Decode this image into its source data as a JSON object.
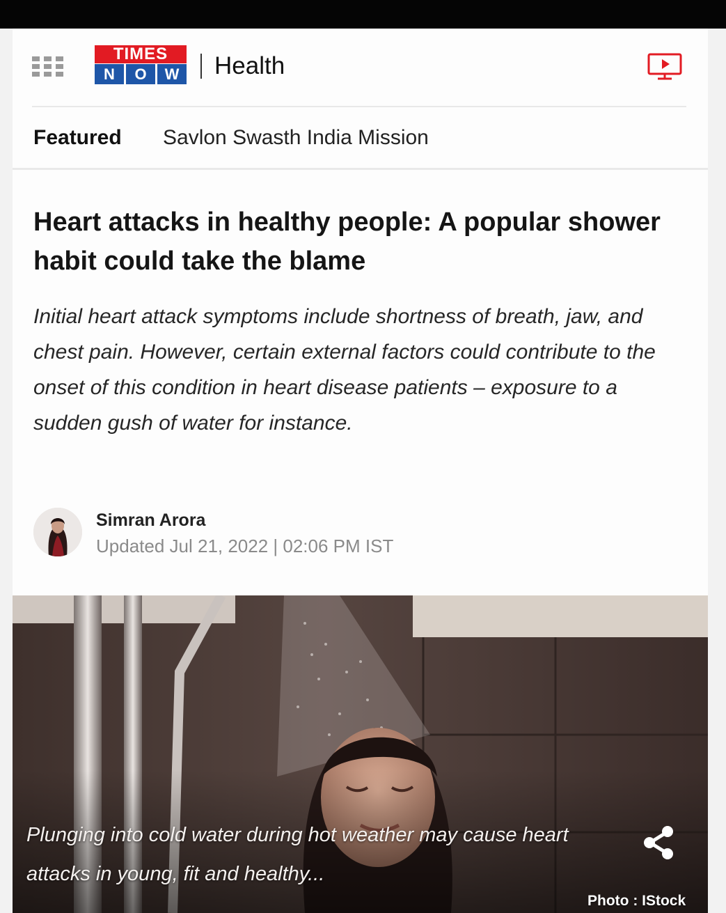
{
  "header": {
    "logo_top": "TIMES",
    "logo_bottom": [
      "N",
      "O",
      "W"
    ],
    "section": "Health",
    "menu_icon": "grid-menu-icon",
    "video_icon": "tv-play-icon"
  },
  "featured": {
    "label": "Featured",
    "link": "Savlon Swasth India Mission"
  },
  "article": {
    "headline": "Heart attacks in healthy people: A popular shower habit could take the blame",
    "summary": "Initial heart attack symptoms include shortness of breath, jaw, and chest pain. However, certain external factors could contribute to the onset of this condition in heart disease patients – exposure to a sudden gush of water for instance.",
    "author": "Simran Arora",
    "updated": "Updated Jul 21, 2022 | 02:06 PM IST"
  },
  "photo": {
    "caption": "Plunging into cold water during hot weather may cause heart attacks in young, fit and healthy...",
    "credit": "Photo : IStock",
    "share_icon": "share-icon"
  },
  "colors": {
    "times_red": "#e21b23",
    "now_blue": "#1e56a8",
    "tile_brown": "#4a3b36"
  }
}
